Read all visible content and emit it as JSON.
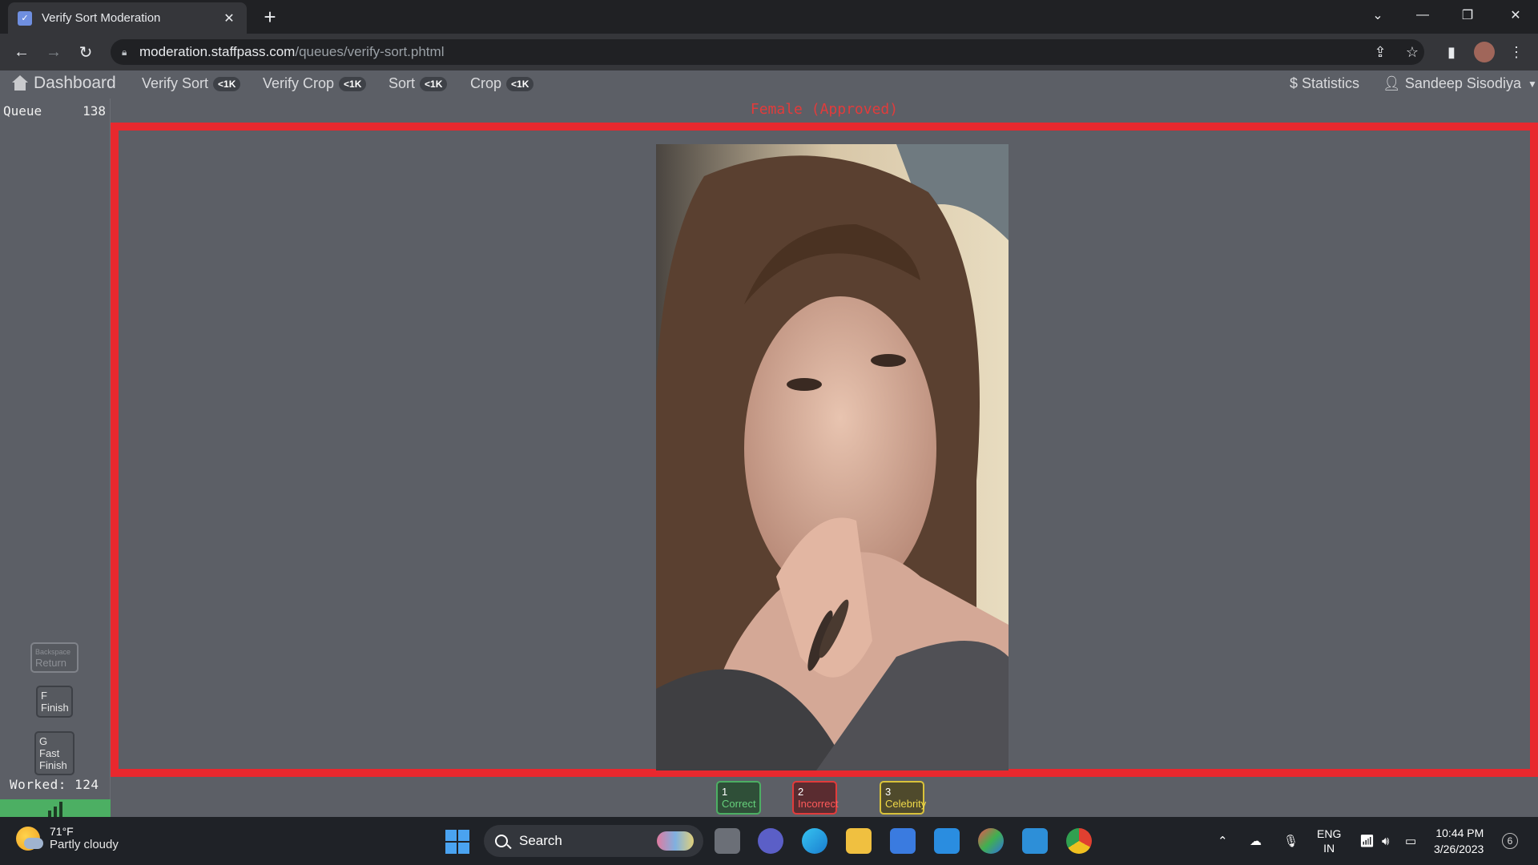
{
  "browser": {
    "tab_title": "Verify Sort Moderation",
    "url_host": "moderation.staffpass.com",
    "url_path": "/queues/verify-sort.phtml"
  },
  "nav": {
    "dashboard": "Dashboard",
    "items": [
      {
        "label": "Verify Sort",
        "badge": "<1K"
      },
      {
        "label": "Verify Crop",
        "badge": "<1K"
      },
      {
        "label": "Sort",
        "badge": "<1K"
      },
      {
        "label": "Crop",
        "badge": "<1K"
      }
    ],
    "statistics": "$ Statistics",
    "user": "Sandeep Sisodiya"
  },
  "sidebar": {
    "queue_label": "Queue",
    "queue_count": "138",
    "keys": [
      {
        "key": "Backspace",
        "label": "Return"
      },
      {
        "key": "F",
        "label": "Finish"
      },
      {
        "key": "G Fast",
        "label": "Finish"
      }
    ],
    "worked": "Worked: 124"
  },
  "main": {
    "status_label": "Female (Approved)",
    "answers": [
      {
        "key": "1",
        "label": "Correct"
      },
      {
        "key": "2",
        "label": "Incorrect"
      },
      {
        "key": "3",
        "label": "Celebrity"
      }
    ]
  },
  "taskbar": {
    "temp": "71°F",
    "weather": "Partly cloudy",
    "search": "Search",
    "lang1": "ENG",
    "lang2": "IN",
    "time": "10:44 PM",
    "date": "3/26/2023",
    "notifications": "6"
  },
  "colors": {
    "accent_red": "#e8282e",
    "correct_green": "#4caf63",
    "celebrity_yellow": "#d9c23a"
  }
}
